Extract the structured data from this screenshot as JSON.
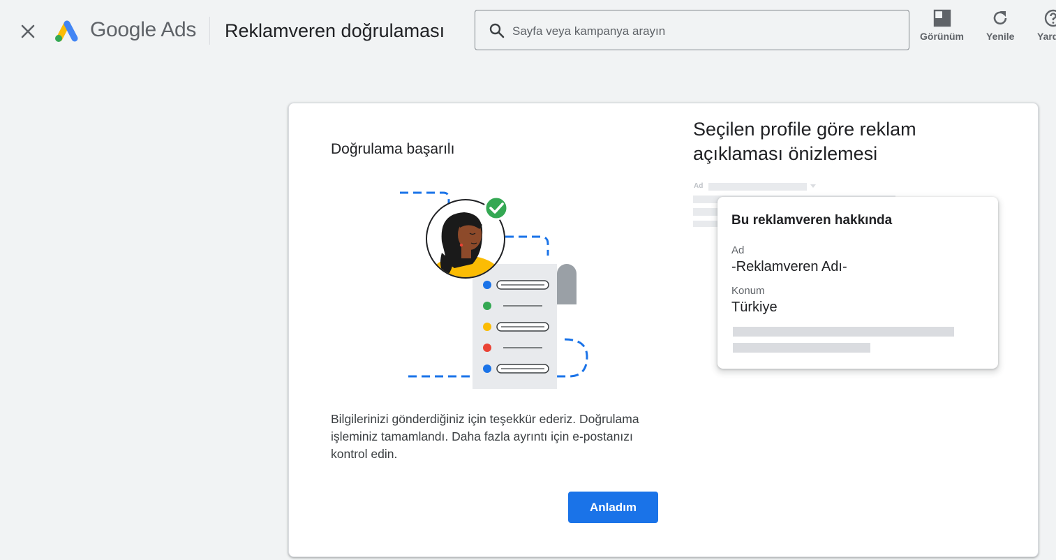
{
  "header": {
    "brand": "Google Ads",
    "page_title": "Reklamveren doğrulaması",
    "search": {
      "placeholder": "Sayfa veya kampanya arayın"
    },
    "tools": [
      {
        "label": "Görünüm",
        "icon": "appearance-icon"
      },
      {
        "label": "Yenile",
        "icon": "refresh-icon"
      },
      {
        "label": "Yardım",
        "icon": "help-icon"
      }
    ]
  },
  "left": {
    "title": "Doğrulama başarılı",
    "body": "Bilgilerinizi gönderdiğiniz için teşekkür ederiz. Doğrulama işleminiz tamamlandı. Daha fazla ayrıntı için e-postanızı kontrol edin.",
    "button": "Anladım"
  },
  "preview": {
    "title": "Seçilen profile göre reklam açıklaması önizlemesi",
    "ad_badge": "Ad",
    "card": {
      "title": "Bu reklamveren hakkında",
      "name_label": "Ad",
      "name_value": "-Reklamveren Adı-",
      "location_label": "Konum",
      "location_value": "Türkiye"
    }
  },
  "colors": {
    "primary": "#1a73e8",
    "illustration_dots": [
      "#1a73e8",
      "#34a853",
      "#fbbc04",
      "#ea4335",
      "#1a73e8"
    ],
    "check_badge": "#34a853"
  }
}
